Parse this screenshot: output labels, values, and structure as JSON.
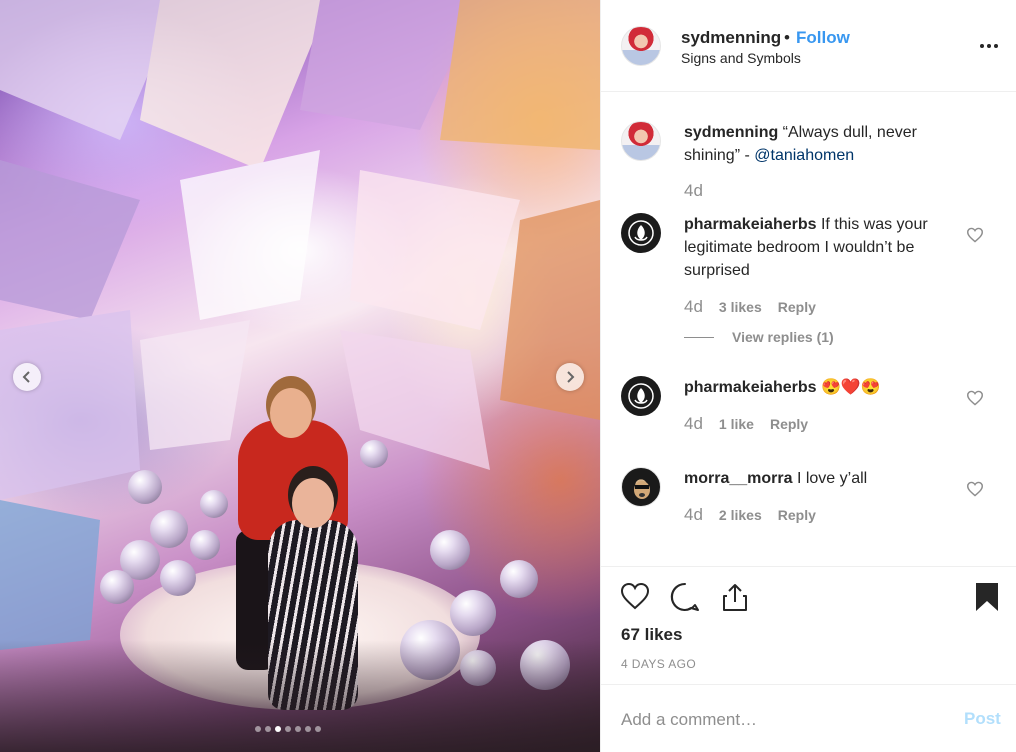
{
  "post": {
    "username": "sydmenning",
    "separator": "•",
    "follow_label": "Follow",
    "location": "Signs and Symbols",
    "photo_count": 7,
    "active_photo_index": 2
  },
  "caption": {
    "username": "sydmenning",
    "text": " “Always dull, never shining” - ",
    "mention": "@taniahomen",
    "time": "4d"
  },
  "comments": [
    {
      "username": "pharmakeiaherbs",
      "text": " If this was your legitimate bedroom I wouldn’t be surprised",
      "time": "4d",
      "likes": "3 likes",
      "reply": "Reply",
      "view_replies": "View replies (1)",
      "avatar_icon": "leaf-logo-icon"
    },
    {
      "username": "pharmakeiaherbs",
      "text": " 😍❤️😍",
      "time": "4d",
      "likes": "1 like",
      "reply": "Reply",
      "avatar_icon": "leaf-logo-icon"
    },
    {
      "username": "morra__morra",
      "text": " I love y’all",
      "time": "4d",
      "likes": "2 likes",
      "reply": "Reply",
      "avatar_icon": "dog-avatar-icon"
    }
  ],
  "actions": {
    "likes_count": "67 likes",
    "date": "4 DAYS AGO"
  },
  "comment_box": {
    "placeholder": "Add a comment…",
    "post_label": "Post"
  },
  "colors": {
    "accent": "#3897f0",
    "mention": "#003569",
    "muted": "#8e8e8e",
    "post_disabled": "#b2dffc"
  }
}
